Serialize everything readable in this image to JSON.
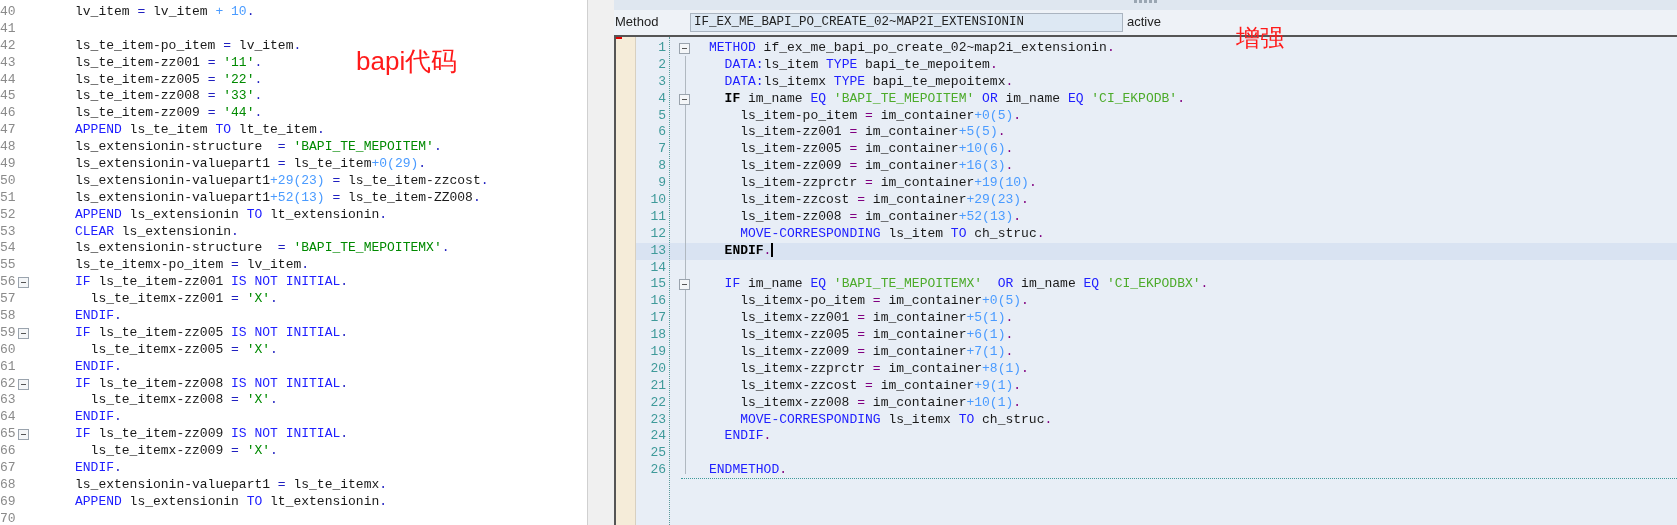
{
  "left_editor": {
    "annotation": "bapi代码",
    "lines": [
      {
        "number": "40",
        "fold": false,
        "tokens": [
          {
            "kind": "plain",
            "text": "lv_item "
          },
          {
            "kind": "op",
            "text": "="
          },
          {
            "kind": "plain",
            "text": " lv_item "
          },
          {
            "kind": "num",
            "text": "+ 10"
          },
          {
            "kind": "op",
            "text": "."
          }
        ]
      },
      {
        "number": "41",
        "fold": false
      },
      {
        "number": "42",
        "fold": false,
        "tokens": [
          {
            "kind": "plain",
            "text": "ls_te_item-po_item "
          },
          {
            "kind": "op",
            "text": "="
          },
          {
            "kind": "plain",
            "text": " lv_item"
          },
          {
            "kind": "op",
            "text": "."
          }
        ]
      },
      {
        "number": "43",
        "fold": false,
        "tokens": [
          {
            "kind": "plain",
            "text": "ls_te_item-zz001 "
          },
          {
            "kind": "op",
            "text": "= "
          },
          {
            "kind": "str",
            "text": "'11'"
          },
          {
            "kind": "op",
            "text": "."
          }
        ]
      },
      {
        "number": "44",
        "fold": false,
        "tokens": [
          {
            "kind": "plain",
            "text": "ls_te_item-zz005 "
          },
          {
            "kind": "op",
            "text": "= "
          },
          {
            "kind": "str",
            "text": "'22'"
          },
          {
            "kind": "op",
            "text": "."
          }
        ]
      },
      {
        "number": "45",
        "fold": false,
        "tokens": [
          {
            "kind": "plain",
            "text": "ls_te_item-zz008 "
          },
          {
            "kind": "op",
            "text": "= "
          },
          {
            "kind": "str",
            "text": "'33'"
          },
          {
            "kind": "op",
            "text": "."
          }
        ]
      },
      {
        "number": "46",
        "fold": false,
        "tokens": [
          {
            "kind": "plain",
            "text": "ls_te_item-zz009 "
          },
          {
            "kind": "op",
            "text": "= "
          },
          {
            "kind": "str",
            "text": "'44'"
          },
          {
            "kind": "op",
            "text": "."
          }
        ]
      },
      {
        "number": "47",
        "fold": false,
        "tokens": [
          {
            "kind": "kw",
            "text": "APPEND"
          },
          {
            "kind": "plain",
            "text": " ls_te_item "
          },
          {
            "kind": "kw",
            "text": "TO"
          },
          {
            "kind": "plain",
            "text": " lt_te_item"
          },
          {
            "kind": "op",
            "text": "."
          }
        ]
      },
      {
        "number": "48",
        "fold": false,
        "tokens": [
          {
            "kind": "plain",
            "text": "ls_extensionin-structure  "
          },
          {
            "kind": "op",
            "text": "= "
          },
          {
            "kind": "str",
            "text": "'BAPI_TE_MEPOITEM'"
          },
          {
            "kind": "op",
            "text": "."
          }
        ]
      },
      {
        "number": "49",
        "fold": false,
        "tokens": [
          {
            "kind": "plain",
            "text": "ls_extensionin-valuepart1 "
          },
          {
            "kind": "op",
            "text": "="
          },
          {
            "kind": "plain",
            "text": " ls_te_item"
          },
          {
            "kind": "num",
            "text": "+0(29)"
          },
          {
            "kind": "op",
            "text": "."
          }
        ]
      },
      {
        "number": "50",
        "fold": false,
        "tokens": [
          {
            "kind": "plain",
            "text": "ls_extensionin-valuepart1"
          },
          {
            "kind": "num",
            "text": "+29(23)"
          },
          {
            "kind": "op",
            "text": " ="
          },
          {
            "kind": "plain",
            "text": " ls_te_item-zzcost"
          },
          {
            "kind": "op",
            "text": "."
          }
        ]
      },
      {
        "number": "51",
        "fold": false,
        "tokens": [
          {
            "kind": "plain",
            "text": "ls_extensionin-valuepart1"
          },
          {
            "kind": "num",
            "text": "+52(13)"
          },
          {
            "kind": "op",
            "text": " ="
          },
          {
            "kind": "plain",
            "text": " ls_te_item-ZZ008"
          },
          {
            "kind": "op",
            "text": "."
          }
        ]
      },
      {
        "number": "52",
        "fold": false,
        "tokens": [
          {
            "kind": "kw",
            "text": "APPEND"
          },
          {
            "kind": "plain",
            "text": " ls_extensionin "
          },
          {
            "kind": "kw",
            "text": "TO"
          },
          {
            "kind": "plain",
            "text": " lt_extensionin"
          },
          {
            "kind": "op",
            "text": "."
          }
        ]
      },
      {
        "number": "53",
        "fold": false,
        "tokens": [
          {
            "kind": "kw",
            "text": "CLEAR"
          },
          {
            "kind": "plain",
            "text": " ls_extensionin"
          },
          {
            "kind": "op",
            "text": "."
          }
        ]
      },
      {
        "number": "54",
        "fold": false,
        "tokens": [
          {
            "kind": "plain",
            "text": "ls_extensionin-structure  "
          },
          {
            "kind": "op",
            "text": "= "
          },
          {
            "kind": "str",
            "text": "'BAPI_TE_MEPOITEMX'"
          },
          {
            "kind": "op",
            "text": "."
          }
        ]
      },
      {
        "number": "55",
        "fold": false,
        "tokens": [
          {
            "kind": "plain",
            "text": "ls_te_itemx-po_item "
          },
          {
            "kind": "op",
            "text": "="
          },
          {
            "kind": "plain",
            "text": " lv_item"
          },
          {
            "kind": "op",
            "text": "."
          }
        ]
      },
      {
        "number": "56",
        "fold": true,
        "tokens": [
          {
            "kind": "kw",
            "text": "IF"
          },
          {
            "kind": "plain",
            "text": " ls_te_item-zz001 "
          },
          {
            "kind": "kw",
            "text": "IS NOT INITIAL"
          },
          {
            "kind": "op",
            "text": "."
          }
        ]
      },
      {
        "number": "57",
        "fold": false,
        "tokens": [
          {
            "kind": "plain",
            "text": "  ls_te_itemx-zz001 "
          },
          {
            "kind": "op",
            "text": "= "
          },
          {
            "kind": "str",
            "text": "'X'"
          },
          {
            "kind": "op",
            "text": "."
          }
        ]
      },
      {
        "number": "58",
        "fold": false,
        "tokens": [
          {
            "kind": "kw",
            "text": "ENDIF"
          },
          {
            "kind": "op",
            "text": "."
          }
        ]
      },
      {
        "number": "59",
        "fold": true,
        "tokens": [
          {
            "kind": "kw",
            "text": "IF"
          },
          {
            "kind": "plain",
            "text": " ls_te_item-zz005 "
          },
          {
            "kind": "kw",
            "text": "IS NOT INITIAL"
          },
          {
            "kind": "op",
            "text": "."
          }
        ]
      },
      {
        "number": "60",
        "fold": false,
        "tokens": [
          {
            "kind": "plain",
            "text": "  ls_te_itemx-zz005 "
          },
          {
            "kind": "op",
            "text": "= "
          },
          {
            "kind": "str",
            "text": "'X'"
          },
          {
            "kind": "op",
            "text": "."
          }
        ]
      },
      {
        "number": "61",
        "fold": false,
        "tokens": [
          {
            "kind": "kw",
            "text": "ENDIF"
          },
          {
            "kind": "op",
            "text": "."
          }
        ]
      },
      {
        "number": "62",
        "fold": true,
        "tokens": [
          {
            "kind": "kw",
            "text": "IF"
          },
          {
            "kind": "plain",
            "text": " ls_te_item-zz008 "
          },
          {
            "kind": "kw",
            "text": "IS NOT INITIAL"
          },
          {
            "kind": "op",
            "text": "."
          }
        ]
      },
      {
        "number": "63",
        "fold": false,
        "tokens": [
          {
            "kind": "plain",
            "text": "  ls_te_itemx-zz008 "
          },
          {
            "kind": "op",
            "text": "= "
          },
          {
            "kind": "str",
            "text": "'X'"
          },
          {
            "kind": "op",
            "text": "."
          }
        ]
      },
      {
        "number": "64",
        "fold": false,
        "tokens": [
          {
            "kind": "kw",
            "text": "ENDIF"
          },
          {
            "kind": "op",
            "text": "."
          }
        ]
      },
      {
        "number": "65",
        "fold": true,
        "tokens": [
          {
            "kind": "kw",
            "text": "IF"
          },
          {
            "kind": "plain",
            "text": " ls_te_item-zz009 "
          },
          {
            "kind": "kw",
            "text": "IS NOT INITIAL"
          },
          {
            "kind": "op",
            "text": "."
          }
        ]
      },
      {
        "number": "66",
        "fold": false,
        "tokens": [
          {
            "kind": "plain",
            "text": "  ls_te_itemx-zz009 "
          },
          {
            "kind": "op",
            "text": "= "
          },
          {
            "kind": "str",
            "text": "'X'"
          },
          {
            "kind": "op",
            "text": "."
          }
        ]
      },
      {
        "number": "67",
        "fold": false,
        "tokens": [
          {
            "kind": "kw",
            "text": "ENDIF"
          },
          {
            "kind": "op",
            "text": "."
          }
        ]
      },
      {
        "number": "68",
        "fold": false,
        "tokens": [
          {
            "kind": "plain",
            "text": "ls_extensionin-valuepart1 "
          },
          {
            "kind": "op",
            "text": "="
          },
          {
            "kind": "plain",
            "text": " ls_te_itemx"
          },
          {
            "kind": "op",
            "text": "."
          }
        ]
      },
      {
        "number": "69",
        "fold": false,
        "tokens": [
          {
            "kind": "kw",
            "text": "APPEND"
          },
          {
            "kind": "plain",
            "text": " ls_extensionin "
          },
          {
            "kind": "kw",
            "text": "TO"
          },
          {
            "kind": "plain",
            "text": " lt_extensionin"
          },
          {
            "kind": "op",
            "text": "."
          }
        ]
      },
      {
        "number": "70",
        "fold": false
      }
    ]
  },
  "right_editor": {
    "method_label": "Method",
    "method_value": "IF_EX_ME_BAPI_PO_CREATE_02~MAP2I_EXTENSIONIN",
    "status": "active",
    "annotation": "增强",
    "lines": [
      {
        "number": "1",
        "fold": true,
        "current": false,
        "tokens": [
          {
            "kind": "kw",
            "text": "METHOD"
          },
          {
            "kind": "plain",
            "text": " if_ex_me_bapi_po_create_02~map2i_extensionin"
          },
          {
            "kind": "op",
            "text": "."
          }
        ]
      },
      {
        "number": "2",
        "fold": false,
        "current": false,
        "tokens": [
          {
            "kind": "kw",
            "text": "  DATA:"
          },
          {
            "kind": "plain",
            "text": "ls_item "
          },
          {
            "kind": "kw",
            "text": "TYPE"
          },
          {
            "kind": "plain",
            "text": " bapi_te_mepoitem"
          },
          {
            "kind": "op",
            "text": "."
          }
        ]
      },
      {
        "number": "3",
        "fold": false,
        "current": false,
        "tokens": [
          {
            "kind": "kw",
            "text": "  DATA:"
          },
          {
            "kind": "plain",
            "text": "ls_itemx "
          },
          {
            "kind": "kw",
            "text": "TYPE"
          },
          {
            "kind": "plain",
            "text": " bapi_te_mepoitemx"
          },
          {
            "kind": "op",
            "text": "."
          }
        ]
      },
      {
        "number": "4",
        "fold": true,
        "current": false,
        "tokens": [
          {
            "kind": "match",
            "text": "  IF"
          },
          {
            "kind": "plain",
            "text": " im_name "
          },
          {
            "kind": "kw",
            "text": "EQ "
          },
          {
            "kind": "str",
            "text": "'BAPI_TE_MEPOITEM'"
          },
          {
            "kind": "kw",
            "text": " OR"
          },
          {
            "kind": "plain",
            "text": " im_name "
          },
          {
            "kind": "kw",
            "text": "EQ "
          },
          {
            "kind": "str",
            "text": "'CI_EKPODB'"
          },
          {
            "kind": "op",
            "text": "."
          }
        ]
      },
      {
        "number": "5",
        "fold": false,
        "current": false,
        "tokens": [
          {
            "kind": "plain",
            "text": "    ls_item-po_item "
          },
          {
            "kind": "op",
            "text": "="
          },
          {
            "kind": "plain",
            "text": " im_container"
          },
          {
            "kind": "num",
            "text": "+0(5)"
          },
          {
            "kind": "op",
            "text": "."
          }
        ]
      },
      {
        "number": "6",
        "fold": false,
        "current": false,
        "tokens": [
          {
            "kind": "plain",
            "text": "    ls_item-zz001 "
          },
          {
            "kind": "op",
            "text": "="
          },
          {
            "kind": "plain",
            "text": " im_container"
          },
          {
            "kind": "num",
            "text": "+5(5)"
          },
          {
            "kind": "op",
            "text": "."
          }
        ]
      },
      {
        "number": "7",
        "fold": false,
        "current": false,
        "tokens": [
          {
            "kind": "plain",
            "text": "    ls_item-zz005 "
          },
          {
            "kind": "op",
            "text": "="
          },
          {
            "kind": "plain",
            "text": " im_container"
          },
          {
            "kind": "num",
            "text": "+10(6)"
          },
          {
            "kind": "op",
            "text": "."
          }
        ]
      },
      {
        "number": "8",
        "fold": false,
        "current": false,
        "tokens": [
          {
            "kind": "plain",
            "text": "    ls_item-zz009 "
          },
          {
            "kind": "op",
            "text": "="
          },
          {
            "kind": "plain",
            "text": " im_container"
          },
          {
            "kind": "num",
            "text": "+16(3)"
          },
          {
            "kind": "op",
            "text": "."
          }
        ]
      },
      {
        "number": "9",
        "fold": false,
        "current": false,
        "tokens": [
          {
            "kind": "plain",
            "text": "    ls_item-zzprctr "
          },
          {
            "kind": "op",
            "text": "="
          },
          {
            "kind": "plain",
            "text": " im_container"
          },
          {
            "kind": "num",
            "text": "+19(10)"
          },
          {
            "kind": "op",
            "text": "."
          }
        ]
      },
      {
        "number": "10",
        "fold": false,
        "current": false,
        "tokens": [
          {
            "kind": "plain",
            "text": "    ls_item-zzcost "
          },
          {
            "kind": "op",
            "text": "="
          },
          {
            "kind": "plain",
            "text": " im_container"
          },
          {
            "kind": "num",
            "text": "+29(23)"
          },
          {
            "kind": "op",
            "text": "."
          }
        ]
      },
      {
        "number": "11",
        "fold": false,
        "current": false,
        "tokens": [
          {
            "kind": "plain",
            "text": "    ls_item-zz008 "
          },
          {
            "kind": "op",
            "text": "="
          },
          {
            "kind": "plain",
            "text": " im_container"
          },
          {
            "kind": "num",
            "text": "+52(13)"
          },
          {
            "kind": "op",
            "text": "."
          }
        ]
      },
      {
        "number": "12",
        "fold": false,
        "current": false,
        "tokens": [
          {
            "kind": "kw",
            "text": "    MOVE-CORRESPONDING"
          },
          {
            "kind": "plain",
            "text": " ls_item "
          },
          {
            "kind": "kw",
            "text": "TO"
          },
          {
            "kind": "plain",
            "text": " ch_struc"
          },
          {
            "kind": "op",
            "text": "."
          }
        ]
      },
      {
        "number": "13",
        "fold": false,
        "current": true,
        "tokens": [
          {
            "kind": "match",
            "text": "  ENDIF"
          },
          {
            "kind": "op",
            "text": "."
          }
        ]
      },
      {
        "number": "14",
        "fold": false,
        "current": false
      },
      {
        "number": "15",
        "fold": true,
        "current": false,
        "tokens": [
          {
            "kind": "kw",
            "text": "  IF"
          },
          {
            "kind": "plain",
            "text": " im_name "
          },
          {
            "kind": "kw",
            "text": "EQ "
          },
          {
            "kind": "str",
            "text": "'BAPI_TE_MEPOITEMX'"
          },
          {
            "kind": "kw",
            "text": "  OR"
          },
          {
            "kind": "plain",
            "text": " im_name "
          },
          {
            "kind": "kw",
            "text": "EQ "
          },
          {
            "kind": "str",
            "text": "'CI_EKPODBX'"
          },
          {
            "kind": "op",
            "text": "."
          }
        ]
      },
      {
        "number": "16",
        "fold": false,
        "current": false,
        "tokens": [
          {
            "kind": "plain",
            "text": "    ls_itemx-po_item "
          },
          {
            "kind": "op",
            "text": "="
          },
          {
            "kind": "plain",
            "text": " im_container"
          },
          {
            "kind": "num",
            "text": "+0(5)"
          },
          {
            "kind": "op",
            "text": "."
          }
        ]
      },
      {
        "number": "17",
        "fold": false,
        "current": false,
        "tokens": [
          {
            "kind": "plain",
            "text": "    ls_itemx-zz001 "
          },
          {
            "kind": "op",
            "text": "="
          },
          {
            "kind": "plain",
            "text": " im_container"
          },
          {
            "kind": "num",
            "text": "+5(1)"
          },
          {
            "kind": "op",
            "text": "."
          }
        ]
      },
      {
        "number": "18",
        "fold": false,
        "current": false,
        "tokens": [
          {
            "kind": "plain",
            "text": "    ls_itemx-zz005 "
          },
          {
            "kind": "op",
            "text": "="
          },
          {
            "kind": "plain",
            "text": " im_container"
          },
          {
            "kind": "num",
            "text": "+6(1)"
          },
          {
            "kind": "op",
            "text": "."
          }
        ]
      },
      {
        "number": "19",
        "fold": false,
        "current": false,
        "tokens": [
          {
            "kind": "plain",
            "text": "    ls_itemx-zz009 "
          },
          {
            "kind": "op",
            "text": "="
          },
          {
            "kind": "plain",
            "text": " im_container"
          },
          {
            "kind": "num",
            "text": "+7(1)"
          },
          {
            "kind": "op",
            "text": "."
          }
        ]
      },
      {
        "number": "20",
        "fold": false,
        "current": false,
        "tokens": [
          {
            "kind": "plain",
            "text": "    ls_itemx-zzprctr "
          },
          {
            "kind": "op",
            "text": "="
          },
          {
            "kind": "plain",
            "text": " im_container"
          },
          {
            "kind": "num",
            "text": "+8(1)"
          },
          {
            "kind": "op",
            "text": "."
          }
        ]
      },
      {
        "number": "21",
        "fold": false,
        "current": false,
        "tokens": [
          {
            "kind": "plain",
            "text": "    ls_itemx-zzcost "
          },
          {
            "kind": "op",
            "text": "="
          },
          {
            "kind": "plain",
            "text": " im_container"
          },
          {
            "kind": "num",
            "text": "+9(1)"
          },
          {
            "kind": "op",
            "text": "."
          }
        ]
      },
      {
        "number": "22",
        "fold": false,
        "current": false,
        "tokens": [
          {
            "kind": "plain",
            "text": "    ls_itemx-zz008 "
          },
          {
            "kind": "op",
            "text": "="
          },
          {
            "kind": "plain",
            "text": " im_container"
          },
          {
            "kind": "num",
            "text": "+10(1)"
          },
          {
            "kind": "op",
            "text": "."
          }
        ]
      },
      {
        "number": "23",
        "fold": false,
        "current": false,
        "tokens": [
          {
            "kind": "kw",
            "text": "    MOVE-CORRESPONDING"
          },
          {
            "kind": "plain",
            "text": " ls_itemx "
          },
          {
            "kind": "kw",
            "text": "TO"
          },
          {
            "kind": "plain",
            "text": " ch_struc"
          },
          {
            "kind": "op",
            "text": "."
          }
        ]
      },
      {
        "number": "24",
        "fold": false,
        "current": false,
        "tokens": [
          {
            "kind": "kw",
            "text": "  ENDIF"
          },
          {
            "kind": "op",
            "text": "."
          }
        ]
      },
      {
        "number": "25",
        "fold": false,
        "current": false
      },
      {
        "number": "26",
        "fold": false,
        "current": false,
        "tokens": [
          {
            "kind": "kw",
            "text": "ENDMETHOD"
          },
          {
            "kind": "op",
            "text": "."
          }
        ]
      }
    ]
  }
}
